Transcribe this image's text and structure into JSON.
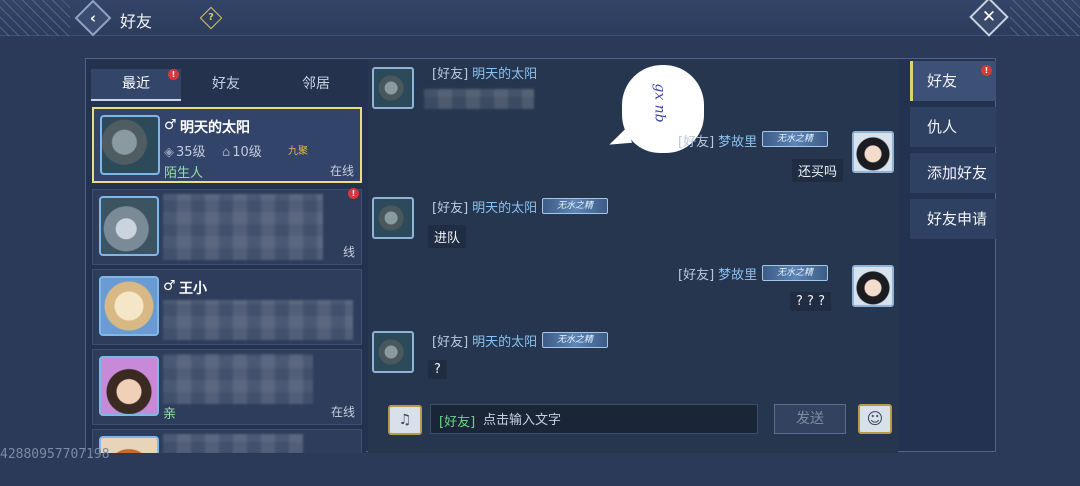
{
  "header": {
    "title": "好友",
    "help_icon": "?"
  },
  "tabs": [
    {
      "label": "最近",
      "active": true,
      "badge": "!"
    },
    {
      "label": "好友",
      "active": false
    },
    {
      "label": "邻居",
      "active": false
    }
  ],
  "friends": [
    {
      "name": "明天的太阳",
      "gender": "♂",
      "level": "35级",
      "rank": "10级",
      "gold_tag": "九聚",
      "relation": "陌生人",
      "status": "在线",
      "avatar": "rhino-avatar",
      "selected": true
    },
    {
      "name": "",
      "status": "线",
      "badge": "!",
      "avatar": "shark-avatar"
    },
    {
      "name": "王小",
      "gender": "♂",
      "avatar": "chick-avatar"
    },
    {
      "name": "",
      "relation": "亲",
      "status": "在线",
      "avatar": "boy-avatar"
    },
    {
      "name": "",
      "avatar": "fox-avatar"
    }
  ],
  "chat": {
    "sticker_text": "gx nb",
    "messages": [
      {
        "side": "left",
        "channel": "[好友]",
        "sender": "明天的太阳",
        "text": ""
      },
      {
        "side": "right",
        "channel": "[好友]",
        "sender": "梦故里",
        "title": "无水之精",
        "text": "还买吗"
      },
      {
        "side": "left",
        "channel": "[好友]",
        "sender": "明天的太阳",
        "title": "无水之精",
        "text": "进队"
      },
      {
        "side": "right",
        "channel": "[好友]",
        "sender": "梦故里",
        "title": "无水之精",
        "text": "? ? ?"
      },
      {
        "side": "left",
        "channel": "[好友]",
        "sender": "明天的太阳",
        "title": "无水之精",
        "text": "?"
      }
    ],
    "input": {
      "prefix": "[好友]",
      "placeholder": "点击输入文字",
      "value": ""
    },
    "send_label": "发送"
  },
  "side_tabs": [
    {
      "label": "好友",
      "active": true,
      "badge": "!"
    },
    {
      "label": "仇人",
      "active": false
    },
    {
      "label": "添加好友",
      "active": false
    },
    {
      "label": "好友申请",
      "active": false
    }
  ],
  "watermark": "42880957707198",
  "colors": {
    "accent": "#e8e07a",
    "online_relation": "#8ee0a8",
    "name_link": "#89c1f2",
    "badge": "#d23a3a"
  }
}
